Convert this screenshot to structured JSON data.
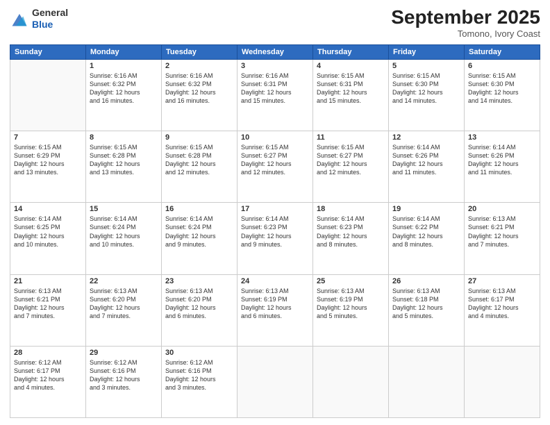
{
  "header": {
    "logo_general": "General",
    "logo_blue": "Blue",
    "month_title": "September 2025",
    "subtitle": "Tomono, Ivory Coast"
  },
  "days_of_week": [
    "Sunday",
    "Monday",
    "Tuesday",
    "Wednesday",
    "Thursday",
    "Friday",
    "Saturday"
  ],
  "weeks": [
    [
      {
        "day": "",
        "info": ""
      },
      {
        "day": "1",
        "info": "Sunrise: 6:16 AM\nSunset: 6:32 PM\nDaylight: 12 hours\nand 16 minutes."
      },
      {
        "day": "2",
        "info": "Sunrise: 6:16 AM\nSunset: 6:32 PM\nDaylight: 12 hours\nand 16 minutes."
      },
      {
        "day": "3",
        "info": "Sunrise: 6:16 AM\nSunset: 6:31 PM\nDaylight: 12 hours\nand 15 minutes."
      },
      {
        "day": "4",
        "info": "Sunrise: 6:15 AM\nSunset: 6:31 PM\nDaylight: 12 hours\nand 15 minutes."
      },
      {
        "day": "5",
        "info": "Sunrise: 6:15 AM\nSunset: 6:30 PM\nDaylight: 12 hours\nand 14 minutes."
      },
      {
        "day": "6",
        "info": "Sunrise: 6:15 AM\nSunset: 6:30 PM\nDaylight: 12 hours\nand 14 minutes."
      }
    ],
    [
      {
        "day": "7",
        "info": "Sunrise: 6:15 AM\nSunset: 6:29 PM\nDaylight: 12 hours\nand 13 minutes."
      },
      {
        "day": "8",
        "info": "Sunrise: 6:15 AM\nSunset: 6:28 PM\nDaylight: 12 hours\nand 13 minutes."
      },
      {
        "day": "9",
        "info": "Sunrise: 6:15 AM\nSunset: 6:28 PM\nDaylight: 12 hours\nand 12 minutes."
      },
      {
        "day": "10",
        "info": "Sunrise: 6:15 AM\nSunset: 6:27 PM\nDaylight: 12 hours\nand 12 minutes."
      },
      {
        "day": "11",
        "info": "Sunrise: 6:15 AM\nSunset: 6:27 PM\nDaylight: 12 hours\nand 12 minutes."
      },
      {
        "day": "12",
        "info": "Sunrise: 6:14 AM\nSunset: 6:26 PM\nDaylight: 12 hours\nand 11 minutes."
      },
      {
        "day": "13",
        "info": "Sunrise: 6:14 AM\nSunset: 6:26 PM\nDaylight: 12 hours\nand 11 minutes."
      }
    ],
    [
      {
        "day": "14",
        "info": "Sunrise: 6:14 AM\nSunset: 6:25 PM\nDaylight: 12 hours\nand 10 minutes."
      },
      {
        "day": "15",
        "info": "Sunrise: 6:14 AM\nSunset: 6:24 PM\nDaylight: 12 hours\nand 10 minutes."
      },
      {
        "day": "16",
        "info": "Sunrise: 6:14 AM\nSunset: 6:24 PM\nDaylight: 12 hours\nand 9 minutes."
      },
      {
        "day": "17",
        "info": "Sunrise: 6:14 AM\nSunset: 6:23 PM\nDaylight: 12 hours\nand 9 minutes."
      },
      {
        "day": "18",
        "info": "Sunrise: 6:14 AM\nSunset: 6:23 PM\nDaylight: 12 hours\nand 8 minutes."
      },
      {
        "day": "19",
        "info": "Sunrise: 6:14 AM\nSunset: 6:22 PM\nDaylight: 12 hours\nand 8 minutes."
      },
      {
        "day": "20",
        "info": "Sunrise: 6:13 AM\nSunset: 6:21 PM\nDaylight: 12 hours\nand 7 minutes."
      }
    ],
    [
      {
        "day": "21",
        "info": "Sunrise: 6:13 AM\nSunset: 6:21 PM\nDaylight: 12 hours\nand 7 minutes."
      },
      {
        "day": "22",
        "info": "Sunrise: 6:13 AM\nSunset: 6:20 PM\nDaylight: 12 hours\nand 7 minutes."
      },
      {
        "day": "23",
        "info": "Sunrise: 6:13 AM\nSunset: 6:20 PM\nDaylight: 12 hours\nand 6 minutes."
      },
      {
        "day": "24",
        "info": "Sunrise: 6:13 AM\nSunset: 6:19 PM\nDaylight: 12 hours\nand 6 minutes."
      },
      {
        "day": "25",
        "info": "Sunrise: 6:13 AM\nSunset: 6:19 PM\nDaylight: 12 hours\nand 5 minutes."
      },
      {
        "day": "26",
        "info": "Sunrise: 6:13 AM\nSunset: 6:18 PM\nDaylight: 12 hours\nand 5 minutes."
      },
      {
        "day": "27",
        "info": "Sunrise: 6:13 AM\nSunset: 6:17 PM\nDaylight: 12 hours\nand 4 minutes."
      }
    ],
    [
      {
        "day": "28",
        "info": "Sunrise: 6:12 AM\nSunset: 6:17 PM\nDaylight: 12 hours\nand 4 minutes."
      },
      {
        "day": "29",
        "info": "Sunrise: 6:12 AM\nSunset: 6:16 PM\nDaylight: 12 hours\nand 3 minutes."
      },
      {
        "day": "30",
        "info": "Sunrise: 6:12 AM\nSunset: 6:16 PM\nDaylight: 12 hours\nand 3 minutes."
      },
      {
        "day": "",
        "info": ""
      },
      {
        "day": "",
        "info": ""
      },
      {
        "day": "",
        "info": ""
      },
      {
        "day": "",
        "info": ""
      }
    ]
  ]
}
